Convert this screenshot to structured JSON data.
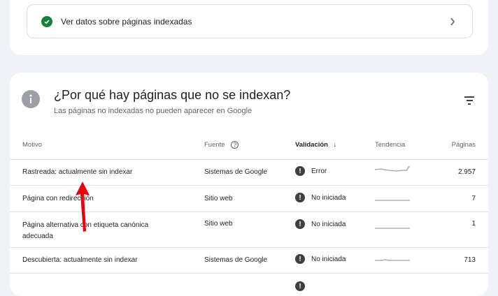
{
  "indexed_link": {
    "label": "Ver datos sobre páginas indexadas"
  },
  "section": {
    "title": "¿Por qué hay páginas que no se indexan?",
    "subtitle": "Las páginas no indexadas no pueden aparecer en Google"
  },
  "table": {
    "headers": {
      "reason": "Motivo",
      "source": "Fuente",
      "validation": "Validación",
      "trend": "Tendencia",
      "pages": "Páginas"
    },
    "rows": [
      {
        "reason": "Rastreada: actualmente sin indexar",
        "source": "Sistemas de Google",
        "validation": "Error",
        "pages": "2.957"
      },
      {
        "reason": "Página con redirección",
        "source": "Sitio web",
        "validation": "No iniciada",
        "pages": "7"
      },
      {
        "reason": "Página alternativa con etiqueta canónica adecuada",
        "source": "Sitio web",
        "validation": "No iniciada",
        "pages": "1"
      },
      {
        "reason": "Descubierta: actualmente sin indexar",
        "source": "Sistemas de Google",
        "validation": "No iniciada",
        "pages": "713"
      }
    ]
  },
  "colors": {
    "success": "#188038",
    "annotation_arrow": "#e8000b"
  }
}
